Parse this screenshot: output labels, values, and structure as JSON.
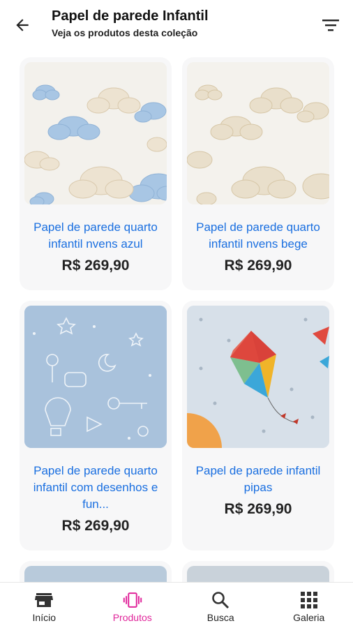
{
  "header": {
    "title": "Papel de parede Infantil",
    "subtitle": "Veja os produtos desta coleção",
    "back_icon": "arrow-left-icon",
    "filter_icon": "filter-icon"
  },
  "products": [
    {
      "name": "Papel de parede quarto infantil nvens azul",
      "price": "R$ 269,90"
    },
    {
      "name": "Papel de parede quarto infantil nvens bege",
      "price": "R$ 269,90"
    },
    {
      "name": "Papel de parede quarto infantil com desenhos e fun...",
      "price": "R$ 269,90"
    },
    {
      "name": "Papel de parede infantil pipas",
      "price": "R$ 269,90"
    }
  ],
  "bottom_nav": [
    {
      "label": "Início",
      "icon": "store-icon",
      "active": false
    },
    {
      "label": "Produtos",
      "icon": "phone-vibrate-icon",
      "active": true
    },
    {
      "label": "Busca",
      "icon": "search-icon",
      "active": false
    },
    {
      "label": "Galeria",
      "icon": "grid-icon",
      "active": false
    }
  ],
  "colors": {
    "accent": "#e0249a",
    "link": "#1a6fe0",
    "card_bg": "#f7f7f8"
  }
}
